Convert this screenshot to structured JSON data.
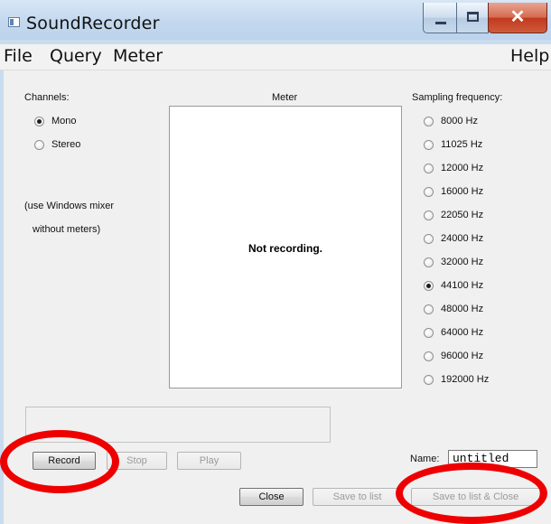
{
  "window": {
    "title": "SoundRecorder"
  },
  "menu": {
    "file": "File",
    "query": "Query",
    "meter": "Meter",
    "help": "Help"
  },
  "channels": {
    "label": "Channels:",
    "options": [
      {
        "label": "Mono",
        "checked": true
      },
      {
        "label": "Stereo",
        "checked": false
      }
    ],
    "note_line1": "(use Windows mixer",
    "note_line2": "without meters)"
  },
  "meter": {
    "label": "Meter",
    "status": "Not recording."
  },
  "sampling": {
    "label": "Sampling frequency:",
    "options": [
      {
        "label": "8000 Hz",
        "checked": false
      },
      {
        "label": "11025 Hz",
        "checked": false
      },
      {
        "label": "12000 Hz",
        "checked": false
      },
      {
        "label": "16000 Hz",
        "checked": false
      },
      {
        "label": "22050 Hz",
        "checked": false
      },
      {
        "label": "24000 Hz",
        "checked": false
      },
      {
        "label": "32000 Hz",
        "checked": false
      },
      {
        "label": "44100 Hz",
        "checked": true
      },
      {
        "label": "48000 Hz",
        "checked": false
      },
      {
        "label": "64000 Hz",
        "checked": false
      },
      {
        "label": "96000 Hz",
        "checked": false
      },
      {
        "label": "192000 Hz",
        "checked": false
      }
    ]
  },
  "buttons": {
    "record": "Record",
    "stop": "Stop",
    "play": "Play",
    "close": "Close",
    "save_to_list": "Save to list",
    "save_to_list_close": "Save to list & Close"
  },
  "name_field": {
    "label": "Name:",
    "value": "untitled"
  },
  "annotation_color": "#ee0000"
}
